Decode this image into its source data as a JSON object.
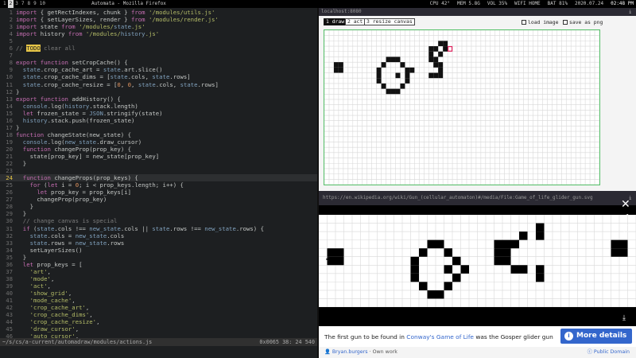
{
  "topbar": {
    "workspaces": [
      "1",
      "2",
      "3",
      "7",
      "8",
      "9",
      "10"
    ],
    "active_workspace": "2",
    "window_title": "Automata - Mozilla Firefox",
    "status": {
      "cpu": "CPU 42°",
      "mem": "MEM 5.8G",
      "vol": "VOL 35%",
      "wifi": "WIFI HOME",
      "bat": "BAT 81%",
      "date": "2020.07.24",
      "time": "02:48 PM"
    }
  },
  "editor": {
    "current_line": 24,
    "lines": [
      {
        "n": "1",
        "t": "import { getRectIndexes, chunk } from '/modules/utils.js'"
      },
      {
        "n": "2",
        "t": "import { setLayerSizes, render } from '/modules/render.js'"
      },
      {
        "n": "3",
        "t": "import state from '/modules/state.js'"
      },
      {
        "n": "4",
        "t": "import history from '/modules/history.js'"
      },
      {
        "n": "5",
        "t": ""
      },
      {
        "n": "6",
        "t": "// TODO clear all"
      },
      {
        "n": "7",
        "t": ""
      },
      {
        "n": "8",
        "t": "export function setCropCache() {"
      },
      {
        "n": "9",
        "t": "  state.crop_cache_art = state.art.slice()"
      },
      {
        "n": "10",
        "t": "  state.crop_cache_dims = [state.cols, state.rows]"
      },
      {
        "n": "11",
        "t": "  state.crop_cache_resize = [0, 0, state.cols, state.rows]"
      },
      {
        "n": "12",
        "t": "}"
      },
      {
        "n": "13",
        "t": "export function addHistory() {"
      },
      {
        "n": "14",
        "t": "  console.log(history.stack.length)"
      },
      {
        "n": "15",
        "t": "  let frozen_state = JSON.stringify(state)"
      },
      {
        "n": "16",
        "t": "  history.stack.push(frozen_state)"
      },
      {
        "n": "17",
        "t": "}"
      },
      {
        "n": "18",
        "t": "function changeState(new_state) {"
      },
      {
        "n": "19",
        "t": "  console.log(new_state.draw_cursor)"
      },
      {
        "n": "20",
        "t": "  function changeProp(prop_key) {"
      },
      {
        "n": "21",
        "t": "    state[prop_key] = new_state[prop_key]"
      },
      {
        "n": "22",
        "t": "  }"
      },
      {
        "n": "23",
        "t": ""
      },
      {
        "n": "24",
        "t": "  function changeProps(prop_keys) {"
      },
      {
        "n": "25",
        "t": "    for (let i = 0; i < prop_keys.length; i++) {"
      },
      {
        "n": "26",
        "t": "      let prop_key = prop_keys[i]"
      },
      {
        "n": "27",
        "t": "      changeProp(prop_key)"
      },
      {
        "n": "28",
        "t": "    }"
      },
      {
        "n": "29",
        "t": "  }"
      },
      {
        "n": "30",
        "t": "  // change canvas is special"
      },
      {
        "n": "31",
        "t": "  if (state.cols !== new_state.cols || state.rows !== new_state.rows) {"
      },
      {
        "n": "32",
        "t": "    state.cols = new_state.cols"
      },
      {
        "n": "33",
        "t": "    state.rows = new_state.rows"
      },
      {
        "n": "34",
        "t": "    setLayerSizes()"
      },
      {
        "n": "35",
        "t": "  }"
      },
      {
        "n": "36",
        "t": "  let prop_keys = ["
      },
      {
        "n": "37",
        "t": "    'art',"
      },
      {
        "n": "38",
        "t": "    'mode',"
      },
      {
        "n": "39",
        "t": "    'act',"
      },
      {
        "n": "40",
        "t": "    'show_grid',"
      },
      {
        "n": "41",
        "t": "    'mode_cache',"
      },
      {
        "n": "42",
        "t": "    'crop_cache_art',"
      },
      {
        "n": "43",
        "t": "    'crop_cache_dims',"
      },
      {
        "n": "44",
        "t": "    'crop_cache_resize',"
      },
      {
        "n": "45",
        "t": "    'draw_cursor',"
      },
      {
        "n": "46",
        "t": "    'auto_cursor',"
      }
    ],
    "modeline": {
      "path": "~/s/cs/a-current/automadraw/modules/actions.js",
      "position": "0x0065  38: 24 540"
    }
  },
  "browser": {
    "url": "localhost:8080",
    "tools": {
      "draw": "1 draw",
      "act": "2 act",
      "resize": "3 resize canvas"
    },
    "load_image": "load image",
    "save_png": "save as png",
    "grid": {
      "cols": 58,
      "rows": 29,
      "cells": [
        [
          2,
          6
        ],
        [
          3,
          6
        ],
        [
          2,
          7
        ],
        [
          3,
          7
        ],
        [
          13,
          5
        ],
        [
          14,
          5
        ],
        [
          15,
          5
        ],
        [
          12,
          6
        ],
        [
          16,
          6
        ],
        [
          11,
          7
        ],
        [
          17,
          7
        ],
        [
          18,
          7
        ],
        [
          11,
          8
        ],
        [
          15,
          8
        ],
        [
          17,
          8
        ],
        [
          11,
          9
        ],
        [
          17,
          9
        ],
        [
          12,
          10
        ],
        [
          16,
          10
        ],
        [
          13,
          11
        ],
        [
          14,
          11
        ],
        [
          15,
          11
        ],
        [
          24,
          2
        ],
        [
          25,
          2
        ],
        [
          22,
          3
        ],
        [
          23,
          3
        ],
        [
          25,
          3
        ],
        [
          22,
          4
        ],
        [
          24,
          4
        ],
        [
          22,
          5
        ],
        [
          23,
          5
        ],
        [
          23,
          6
        ],
        [
          24,
          6
        ],
        [
          24,
          7
        ],
        [
          24,
          8
        ],
        [
          23,
          8
        ],
        [
          22,
          8
        ]
      ],
      "highlight": [
        26,
        3
      ]
    }
  },
  "wiki": {
    "url": "https://en.wikipedia.org/wiki/Gun_(cellular_automaton)#/media/File:Game_of_life_glider_gun.svg",
    "grid": {
      "cols": 38,
      "rows": 11,
      "cells": [
        [
          1,
          4
        ],
        [
          2,
          4
        ],
        [
          1,
          5
        ],
        [
          2,
          5
        ],
        [
          13,
          3
        ],
        [
          14,
          3
        ],
        [
          12,
          4
        ],
        [
          15,
          4
        ],
        [
          11,
          5
        ],
        [
          16,
          5
        ],
        [
          11,
          6
        ],
        [
          15,
          6
        ],
        [
          17,
          6
        ],
        [
          11,
          7
        ],
        [
          16,
          7
        ],
        [
          12,
          8
        ],
        [
          15,
          8
        ],
        [
          13,
          9
        ],
        [
          14,
          9
        ],
        [
          26,
          1
        ],
        [
          24,
          2
        ],
        [
          26,
          2
        ],
        [
          21,
          3
        ],
        [
          22,
          3
        ],
        [
          23,
          3
        ],
        [
          21,
          4
        ],
        [
          22,
          4
        ],
        [
          21,
          5
        ],
        [
          22,
          5
        ],
        [
          23,
          6
        ],
        [
          24,
          6
        ],
        [
          26,
          6
        ],
        [
          26,
          7
        ],
        [
          35,
          3
        ],
        [
          36,
          3
        ],
        [
          35,
          4
        ],
        [
          36,
          4
        ]
      ]
    },
    "caption_prefix": "The first gun to be found in ",
    "caption_link": "Conway's Game of Life",
    "caption_suffix": " was the Gosper glider gun",
    "more_details": "More details",
    "author": "Bryan.burgers",
    "author_suffix": " · Own work",
    "license": "Public Domain",
    "icons": {
      "close": "close-icon",
      "expand": "expand-icon",
      "info": "info-icon",
      "download": "download-icon",
      "prev": "prev-icon"
    }
  }
}
